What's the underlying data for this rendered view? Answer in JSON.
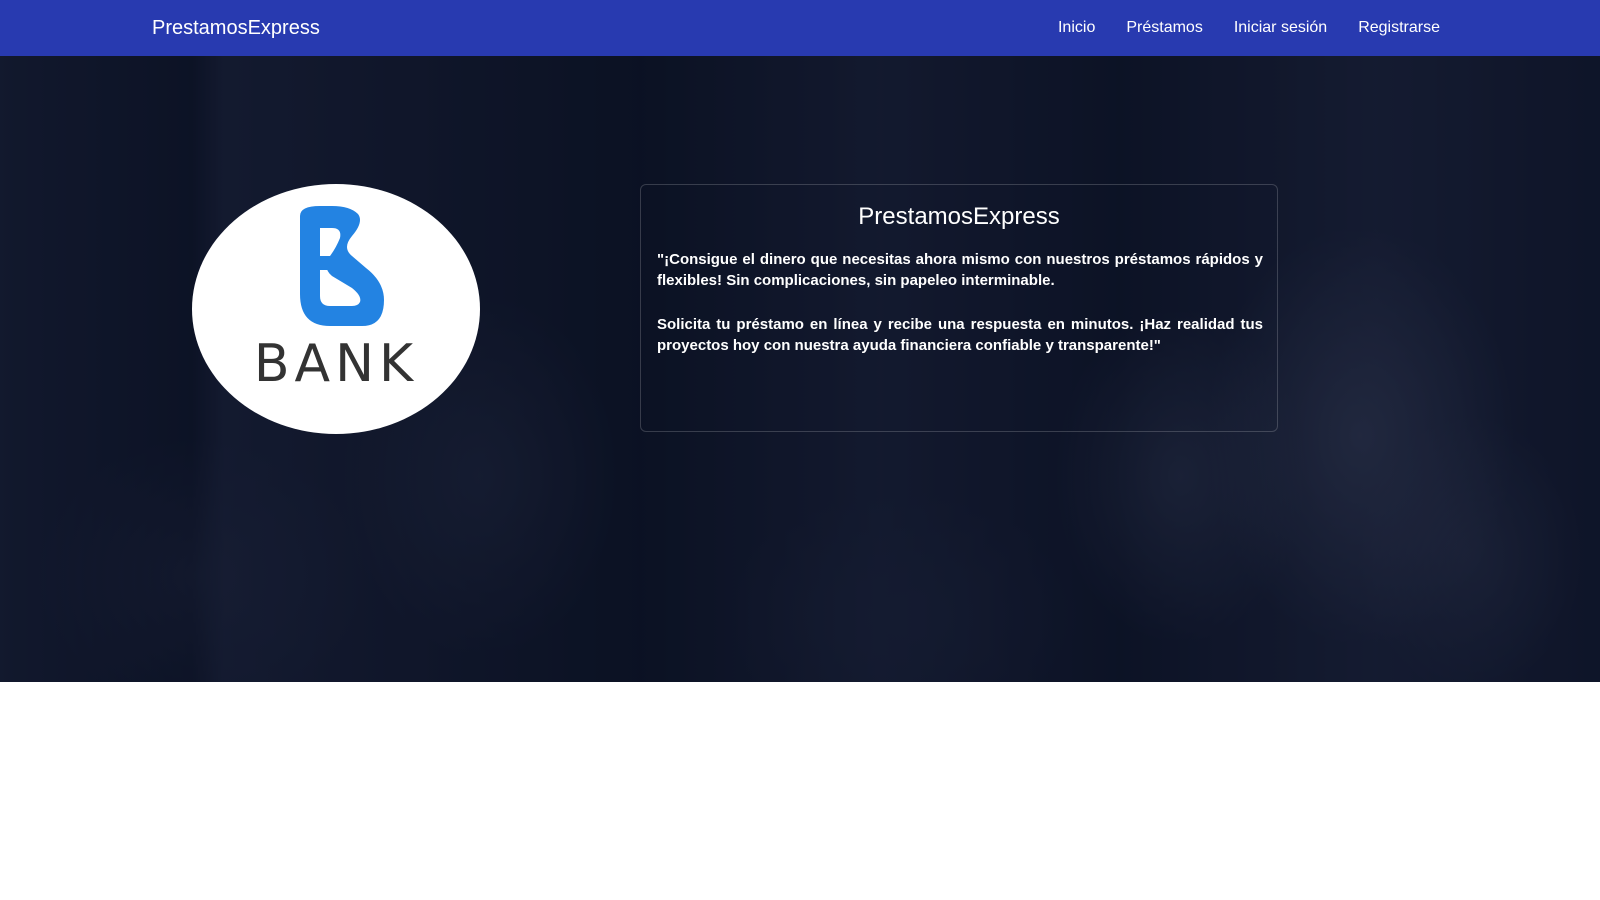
{
  "navbar": {
    "brand": "PrestamosExpress",
    "links": [
      "Inicio",
      "Préstamos",
      "Iniciar sesión",
      "Registrarse"
    ],
    "background": "#283ab0"
  },
  "hero": {
    "logo": {
      "text": "BANK",
      "icon_color": "#2383e2"
    },
    "card": {
      "title": "PrestamosExpress",
      "paragraph1": "\"¡Consigue el dinero que necesitas ahora mismo con nuestros préstamos rápidos y flexibles! Sin complicaciones, sin papeleo interminable.",
      "paragraph2": "Solicita tu préstamo en línea y recibe una respuesta en minutos. ¡Haz realidad tus proyectos hoy con nuestra ayuda financiera confiable y transparente!\""
    }
  }
}
